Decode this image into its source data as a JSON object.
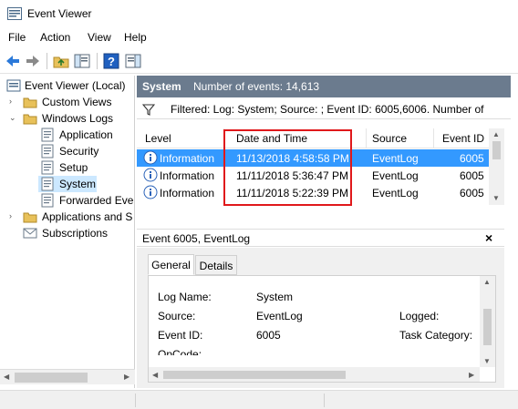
{
  "window": {
    "title": "Event Viewer"
  },
  "menu": [
    "File",
    "Action",
    "View",
    "Help"
  ],
  "toolbar": {
    "buttons": [
      "back-arrow-icon",
      "forward-arrow-icon",
      "folder-up-icon",
      "show-hide-tree-icon",
      "help-icon",
      "action-pane-icon"
    ]
  },
  "tree": {
    "root": "Event Viewer (Local)",
    "items": [
      {
        "label": "Custom Views",
        "level": 1,
        "expander": "›"
      },
      {
        "label": "Windows Logs",
        "level": 1,
        "expander": "⌄"
      },
      {
        "label": "Application",
        "level": 2
      },
      {
        "label": "Security",
        "level": 2
      },
      {
        "label": "Setup",
        "level": 2
      },
      {
        "label": "System",
        "level": 2,
        "selected": true
      },
      {
        "label": "Forwarded Eve",
        "level": 2
      },
      {
        "label": "Applications and S",
        "level": 1,
        "expander": "›"
      },
      {
        "label": "Subscriptions",
        "level": 1
      }
    ]
  },
  "main": {
    "header_title": "System",
    "header_count": "Number of events: 14,613",
    "filter_text": "Filtered: Log: System; Source: ; Event ID: 6005,6006. Number of"
  },
  "grid": {
    "columns": [
      "Level",
      "Date and Time",
      "Source",
      "Event ID"
    ],
    "rows": [
      {
        "level": "Information",
        "datetime": "11/13/2018 4:58:58 PM",
        "source": "EventLog",
        "event_id": "6005",
        "selected": true
      },
      {
        "level": "Information",
        "datetime": "11/11/2018 5:36:47 PM",
        "source": "EventLog",
        "event_id": "6005"
      },
      {
        "level": "Information",
        "datetime": "11/11/2018 5:22:39 PM",
        "source": "EventLog",
        "event_id": "6005"
      }
    ]
  },
  "detail": {
    "title": "Event 6005, EventLog",
    "close": "×",
    "tabs": [
      "General",
      "Details"
    ],
    "fields": {
      "log_name_label": "Log Name:",
      "log_name_value": "System",
      "source_label": "Source:",
      "source_value": "EventLog",
      "event_id_label": "Event ID:",
      "event_id_value": "6005",
      "logged_label": "Logged:",
      "task_category_label": "Task Category:",
      "opcode_label": "OpCode:"
    }
  },
  "colors": {
    "header_bg": "#6b7b8e",
    "selection": "#3399ff",
    "tree_selection": "#cce8ff",
    "highlight_box": "#e0181b"
  }
}
